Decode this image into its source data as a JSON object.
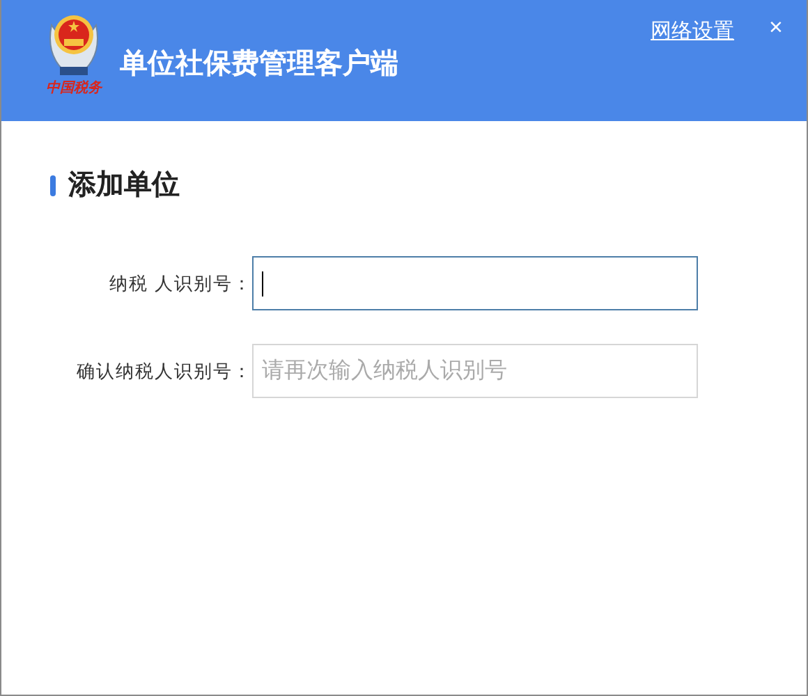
{
  "header": {
    "logo_text": "中国税务",
    "title": "单位社保费管理客户端",
    "link": "网络设置",
    "close": "×"
  },
  "section": {
    "title": "添加单位"
  },
  "fields": [
    {
      "label": "纳税 人识别号：",
      "focused": true
    },
    {
      "label": "确认纳税人识别号：",
      "placeholder": "请再次输入纳税人识别号",
      "focused": false
    }
  ]
}
